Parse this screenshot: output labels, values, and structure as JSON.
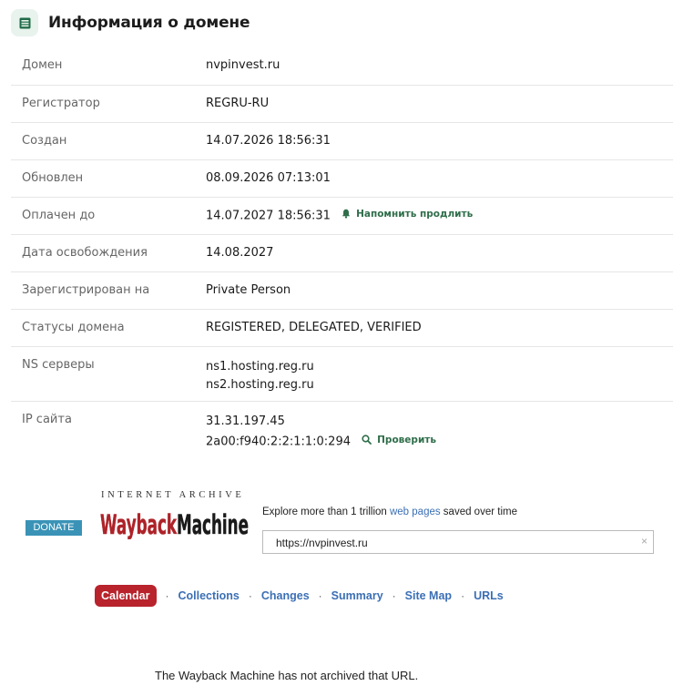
{
  "header": {
    "title": "Информация о домене",
    "icon": "table-icon"
  },
  "rows": [
    {
      "label": "Домен",
      "value": "nvpinvest.ru"
    },
    {
      "label": "Регистратор",
      "value": "REGRU-RU"
    },
    {
      "label": "Создан",
      "value": "14.07.2026 18:56:31"
    },
    {
      "label": "Обновлен",
      "value": "08.09.2026 07:13:01"
    },
    {
      "label": "Оплачен до",
      "value": "14.07.2027 18:56:31",
      "action": "Напомнить продлить",
      "action_icon": "bell-icon"
    },
    {
      "label": "Дата освобождения",
      "value": "14.08.2027"
    },
    {
      "label": "Зарегистрирован на",
      "value": "Private Person"
    },
    {
      "label": "Статусы домена",
      "value": "REGISTERED, DELEGATED, VERIFIED"
    },
    {
      "label": "NS серверы",
      "values": [
        "ns1.hosting.reg.ru",
        "ns2.hosting.reg.ru"
      ]
    },
    {
      "label": "IP сайта",
      "values": [
        "31.31.197.45",
        "2a00:f940:2:2:1:1:0:294"
      ],
      "action": "Проверить",
      "action_icon": "search-icon"
    }
  ],
  "wayback": {
    "donate": "DONATE",
    "ia_label": "INTERNET ARCHIVE",
    "logo_text": "WaybackMachine",
    "explore_prefix": "Explore more than 1 trillion ",
    "explore_link": "web pages",
    "explore_suffix": " saved over time",
    "url_value": "https://nvpinvest.ru",
    "clear": "×"
  },
  "nav": {
    "calendar": "Calendar",
    "items": [
      "Collections",
      "Changes",
      "Summary",
      "Site Map",
      "URLs"
    ],
    "separator": "·"
  },
  "message": "The Wayback Machine has not archived that URL.",
  "colors": {
    "accent_green": "#2f6e4a",
    "calendar_red": "#b8232c",
    "link_blue": "#3b6fb5",
    "donate_blue": "#3a93b7"
  }
}
